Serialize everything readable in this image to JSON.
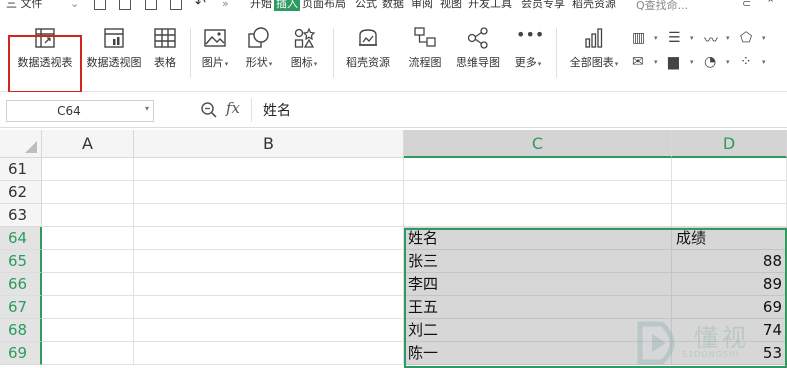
{
  "menubar": {
    "file_menu": "三 文件",
    "tabs": [
      "开始",
      "插入",
      "页面布局",
      "公式",
      "数据",
      "审阅",
      "视图",
      "开发工具",
      "会员专享",
      "稻壳资源"
    ],
    "active_tab": "插入",
    "search_placeholder": "Q查找命..."
  },
  "ribbon": {
    "buttons": [
      {
        "label": "数据透视表",
        "icon": "pivot-table-icon"
      },
      {
        "label": "数据透视图",
        "icon": "pivot-chart-icon"
      },
      {
        "label": "表格",
        "icon": "table-icon"
      },
      {
        "label": "图片",
        "icon": "picture-icon",
        "dropdown": true
      },
      {
        "label": "形状",
        "icon": "shape-icon",
        "dropdown": true
      },
      {
        "label": "图标",
        "icon": "icon-library-icon",
        "dropdown": true
      },
      {
        "label": "稻壳资源",
        "icon": "docer-resource-icon"
      },
      {
        "label": "流程图",
        "icon": "flowchart-icon"
      },
      {
        "label": "思维导图",
        "icon": "mindmap-icon"
      },
      {
        "label": "更多",
        "icon": "more-icon",
        "dropdown": true
      },
      {
        "label": "全部图表",
        "icon": "all-charts-icon",
        "dropdown": true
      }
    ],
    "highlighted": "数据透视表"
  },
  "formula_bar": {
    "cell_ref": "C64",
    "fx_label": "fx",
    "value": "姓名"
  },
  "sheet": {
    "columns": [
      "A",
      "B",
      "C",
      "D"
    ],
    "selected_columns": [
      "C",
      "D"
    ],
    "rows": [
      "61",
      "62",
      "63",
      "64",
      "65",
      "66",
      "67",
      "68",
      "69"
    ],
    "selected_rows": [
      "64",
      "65",
      "66",
      "67",
      "68",
      "69"
    ],
    "table": {
      "header": [
        "姓名",
        "成绩"
      ],
      "records": [
        [
          "张三",
          "88"
        ],
        [
          "李四",
          "89"
        ],
        [
          "王五",
          "69"
        ],
        [
          "刘二",
          "74"
        ],
        [
          "陈一",
          "53"
        ]
      ]
    }
  },
  "watermark": {
    "text": "懂视",
    "sub": "51DONGSHI"
  },
  "colors": {
    "accent": "#2d9b5f",
    "highlight_box": "#d3241f",
    "selection_fill": "#d7d7d7"
  }
}
